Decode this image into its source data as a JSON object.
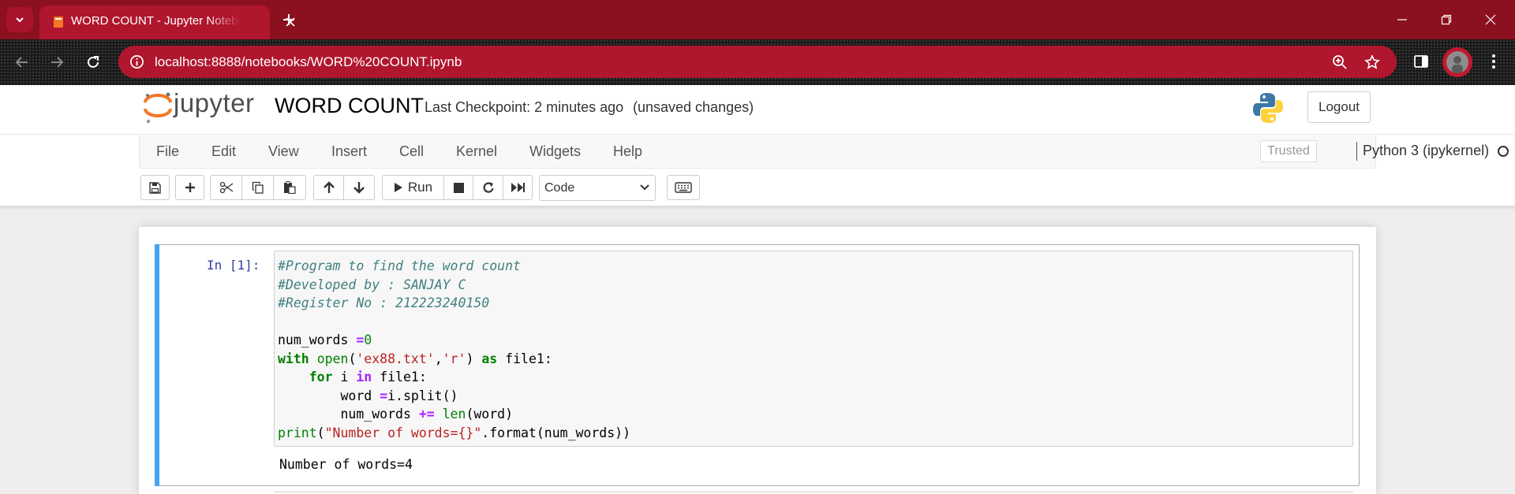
{
  "browser": {
    "tab_title": "WORD COUNT - Jupyter Notebook",
    "url": "localhost:8888/notebooks/WORD%20COUNT.ipynb",
    "theme_color": "#8b1020"
  },
  "header": {
    "logo_text": "jupyter",
    "notebook_title": "WORD COUNT",
    "checkpoint": "Last Checkpoint: 2 minutes ago",
    "save_status": "(unsaved changes)",
    "logout_label": "Logout"
  },
  "menubar": {
    "items": [
      "File",
      "Edit",
      "View",
      "Insert",
      "Cell",
      "Kernel",
      "Widgets",
      "Help"
    ],
    "trusted_label": "Trusted",
    "kernel_name": "Python 3 (ipykernel)"
  },
  "toolbar": {
    "run_label": "Run",
    "cell_type": "Code"
  },
  "cell": {
    "prompt": "In [1]:",
    "output": "Number of words=4"
  }
}
